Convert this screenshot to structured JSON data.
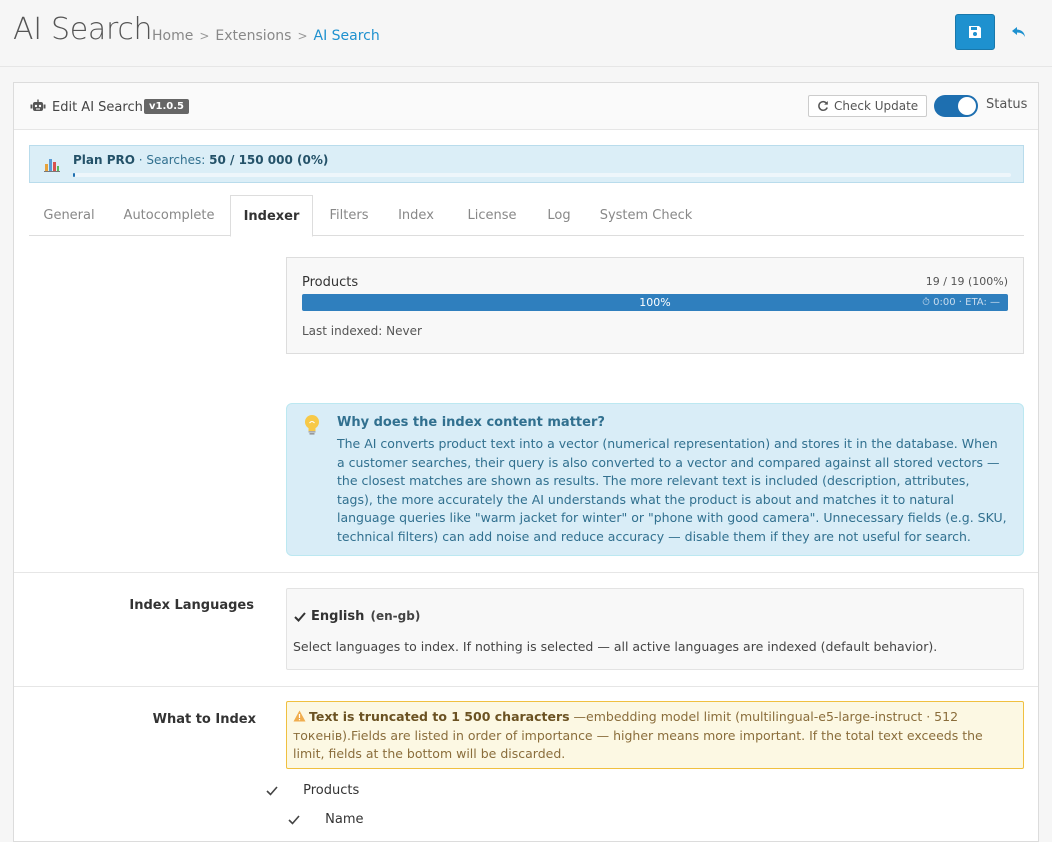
{
  "header": {
    "title": "AI Search",
    "breadcrumb": [
      {
        "label": "Home"
      },
      {
        "label": "Extensions"
      },
      {
        "label": "AI Search"
      }
    ],
    "save_icon": "floppy-icon",
    "back_icon": "reply-icon"
  },
  "panel": {
    "title": "Edit AI Search",
    "version": "v1.0.5",
    "check_update_label": "Check Update",
    "status_label": "Status",
    "status_on": true
  },
  "plan": {
    "name": "Plan PRO",
    "searches_label": " · Searches: ",
    "usage": "50 / 150 000 (0%)",
    "usage_fraction": 0.0003
  },
  "tabs": [
    {
      "label": "General",
      "active": false
    },
    {
      "label": "Autocomplete",
      "active": false
    },
    {
      "label": "Indexer",
      "active": true
    },
    {
      "label": "Filters",
      "active": false
    },
    {
      "label": "Index",
      "active": false
    },
    {
      "label": "License",
      "active": false
    },
    {
      "label": "Log",
      "active": false
    },
    {
      "label": "System Check",
      "active": false
    }
  ],
  "indexer": {
    "title": "Products",
    "count": "19 / 19 (100%)",
    "progress_percent": 100,
    "progress_label": "100%",
    "eta": "⏱ 0:00 · ETA: —",
    "last_indexed": "Last indexed: Never"
  },
  "info": {
    "title": "Why does the index content matter?",
    "body": "The AI converts product text into a vector (numerical representation) and stores it in the database. When a customer searches, their query is also converted to a vector and compared against all stored vectors — the closest matches are shown as results. The more relevant text is included (description, attributes, tags), the more accurately the AI understands what the product is about and matches it to natural language queries like \"warm jacket for winter\" or \"phone with good camera\". Unnecessary fields (e.g. SKU, technical filters) can add noise and reduce accuracy — disable them if they are not useful for search."
  },
  "languages": {
    "label": "Index Languages",
    "items": [
      {
        "name": "English",
        "code": "(en-gb)",
        "checked": true
      }
    ],
    "help": "Select languages to index. If nothing is selected — all active languages are indexed (default behavior)."
  },
  "what_to_index": {
    "label": "What to Index",
    "warning_bold": "Text is truncated to 1 500 characters",
    "warning_text": " —embedding model limit (multilingual-e5-large-instruct · 512 токенів).Fields are listed in order of importance — higher means more important. If the total text exceeds the limit, fields at the bottom will be discarded.",
    "fields": [
      {
        "label": "Products",
        "checked": true
      },
      {
        "label": "Name",
        "checked": true
      }
    ]
  }
}
